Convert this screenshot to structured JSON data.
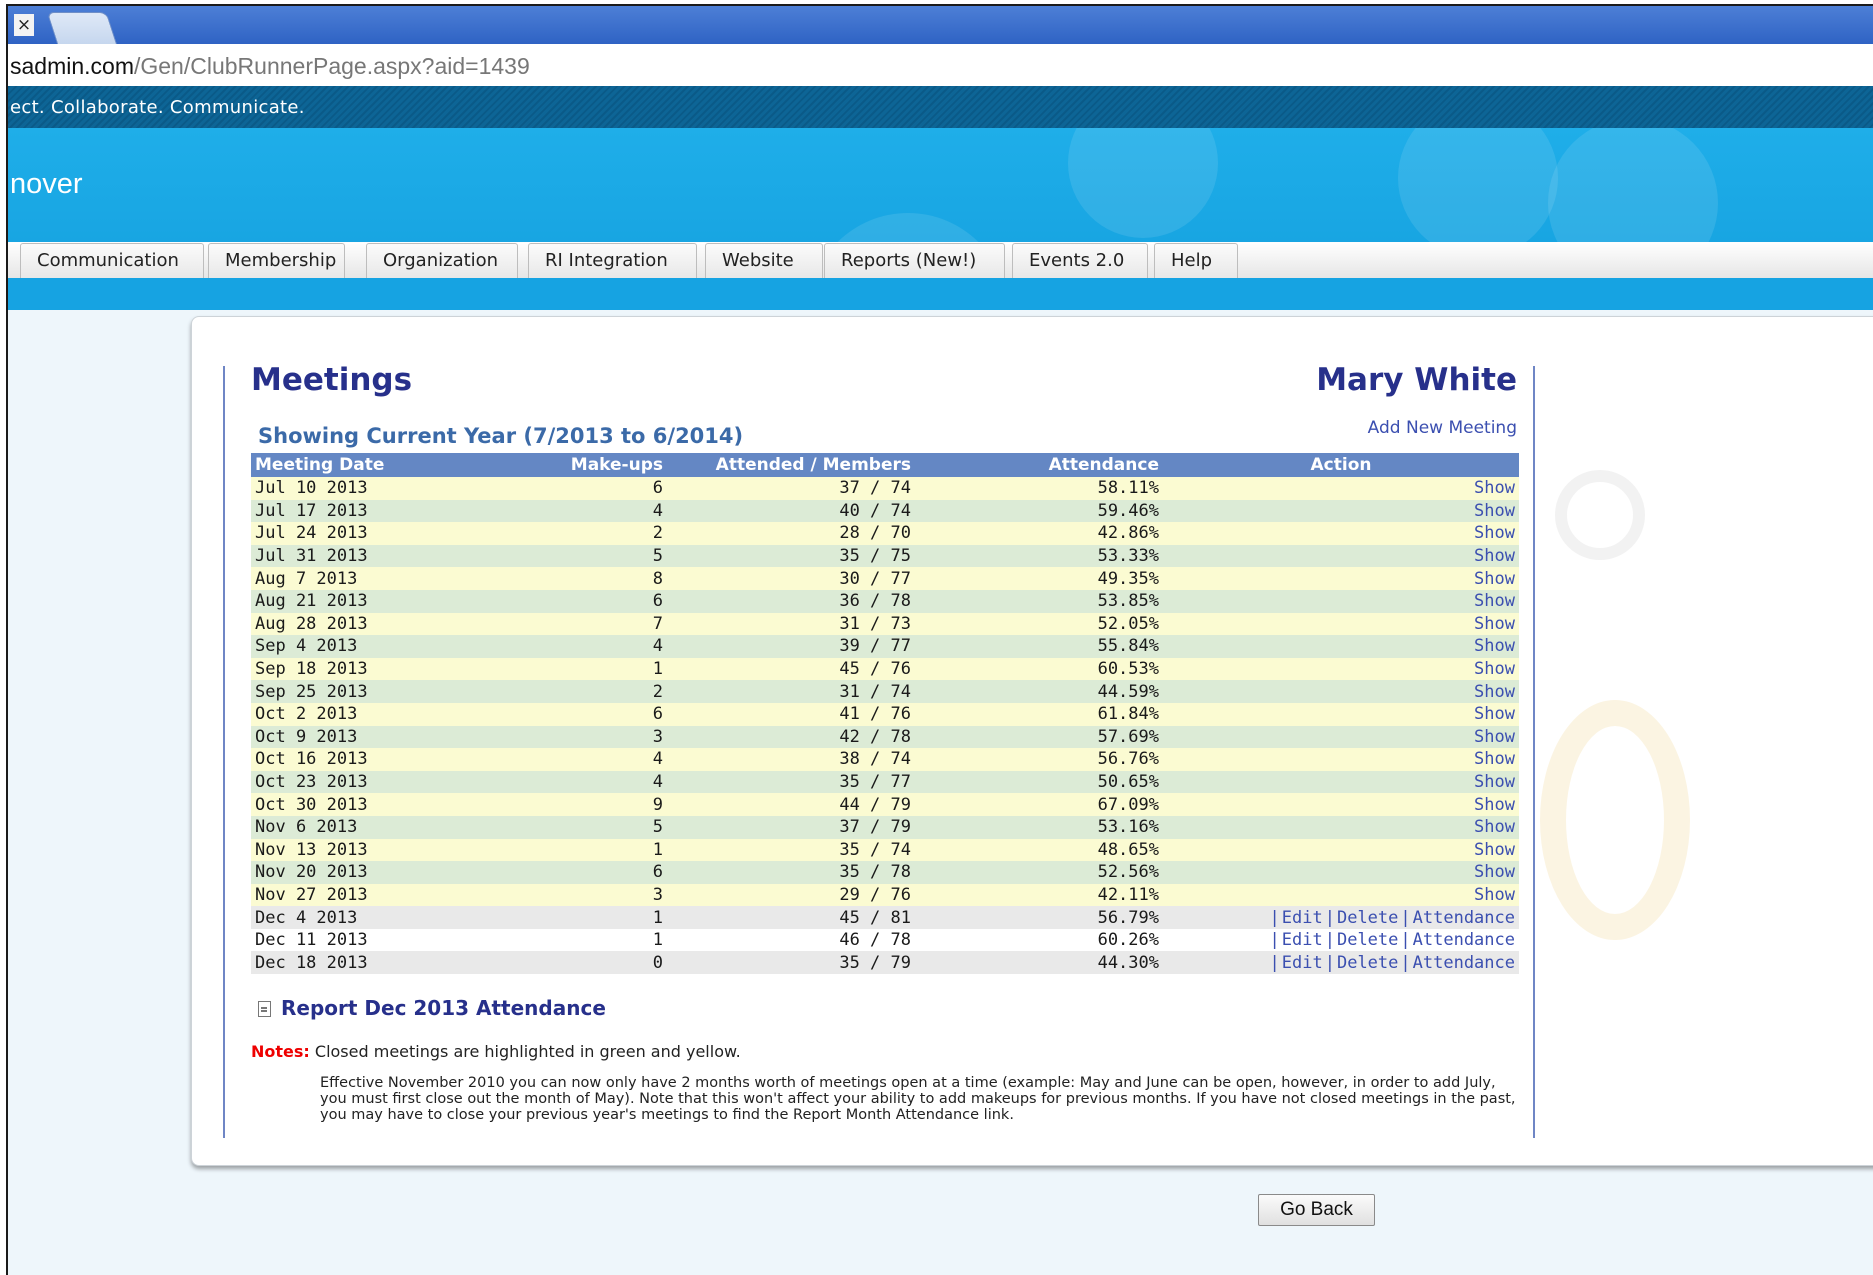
{
  "browser": {
    "tab_close": "×",
    "url_host": "sadmin.com",
    "url_path": "/Gen/ClubRunnerPage.aspx?aid=1439"
  },
  "header": {
    "tagline": "ect. Collaborate. Communicate.",
    "site_title": "nover"
  },
  "nav": {
    "items": [
      "Communication",
      "Membership",
      "Organization",
      "RI Integration",
      "Website",
      "Reports (New!)",
      "Events 2.0",
      "Help"
    ]
  },
  "main": {
    "title": "Meetings",
    "user_name": "Mary White",
    "showing": "Showing Current Year (7/2013 to 6/2014)",
    "add_new": "Add New Meeting",
    "columns": {
      "date": "Meeting Date",
      "makeups": "Make-ups",
      "attended": "Attended /  Members",
      "attendance": "Attendance",
      "action": "Action"
    },
    "rows": [
      {
        "date": "Jul 10 2013",
        "makeups": "6",
        "attended": "37 /  74",
        "pct": "58.11%",
        "status": "closed"
      },
      {
        "date": "Jul 17 2013",
        "makeups": "4",
        "attended": "40 /  74",
        "pct": "59.46%",
        "status": "closed"
      },
      {
        "date": "Jul 24 2013",
        "makeups": "2",
        "attended": "28 /  70",
        "pct": "42.86%",
        "status": "closed"
      },
      {
        "date": "Jul 31 2013",
        "makeups": "5",
        "attended": "35 /  75",
        "pct": "53.33%",
        "status": "closed"
      },
      {
        "date": "Aug 7 2013",
        "makeups": "8",
        "attended": "30 /  77",
        "pct": "49.35%",
        "status": "closed"
      },
      {
        "date": "Aug 21 2013",
        "makeups": "6",
        "attended": "36 /  78",
        "pct": "53.85%",
        "status": "closed"
      },
      {
        "date": "Aug 28 2013",
        "makeups": "7",
        "attended": "31 /  73",
        "pct": "52.05%",
        "status": "closed"
      },
      {
        "date": "Sep 4 2013",
        "makeups": "4",
        "attended": "39 /  77",
        "pct": "55.84%",
        "status": "closed"
      },
      {
        "date": "Sep 18 2013",
        "makeups": "1",
        "attended": "45 /  76",
        "pct": "60.53%",
        "status": "closed"
      },
      {
        "date": "Sep 25 2013",
        "makeups": "2",
        "attended": "31 /  74",
        "pct": "44.59%",
        "status": "closed"
      },
      {
        "date": "Oct 2 2013",
        "makeups": "6",
        "attended": "41 /  76",
        "pct": "61.84%",
        "status": "closed"
      },
      {
        "date": "Oct 9 2013",
        "makeups": "3",
        "attended": "42 /  78",
        "pct": "57.69%",
        "status": "closed"
      },
      {
        "date": "Oct 16 2013",
        "makeups": "4",
        "attended": "38 /  74",
        "pct": "56.76%",
        "status": "closed"
      },
      {
        "date": "Oct 23 2013",
        "makeups": "4",
        "attended": "35 /  77",
        "pct": "50.65%",
        "status": "closed"
      },
      {
        "date": "Oct 30 2013",
        "makeups": "9",
        "attended": "44 /  79",
        "pct": "67.09%",
        "status": "closed"
      },
      {
        "date": "Nov 6 2013",
        "makeups": "5",
        "attended": "37 /  79",
        "pct": "53.16%",
        "status": "closed"
      },
      {
        "date": "Nov 13 2013",
        "makeups": "1",
        "attended": "35 /  74",
        "pct": "48.65%",
        "status": "closed"
      },
      {
        "date": "Nov 20 2013",
        "makeups": "6",
        "attended": "35 /  78",
        "pct": "52.56%",
        "status": "closed"
      },
      {
        "date": "Nov 27 2013",
        "makeups": "3",
        "attended": "29 /  76",
        "pct": "42.11%",
        "status": "closed"
      },
      {
        "date": "Dec 4 2013",
        "makeups": "1",
        "attended": "45 /  81",
        "pct": "56.79%",
        "status": "open"
      },
      {
        "date": "Dec 11 2013",
        "makeups": "1",
        "attended": "46 /  78",
        "pct": "60.26%",
        "status": "open"
      },
      {
        "date": "Dec 18 2013",
        "makeups": "0",
        "attended": "35 /  79",
        "pct": "44.30%",
        "status": "open"
      }
    ],
    "actions": {
      "show": "Show",
      "separator": "|",
      "edit": "Edit",
      "delete": "Delete",
      "attendance": "Attendance"
    },
    "report_link": "Report Dec  2013 Attendance",
    "notes_label": "Notes:",
    "notes_text": " Closed meetings are highlighted in green and yellow.",
    "notes_paragraph": "Effective November 2010 you can now only have 2 months worth of meetings open at a time (example: May and June can be open, however, in order to add July, you must first close out the month of May). Note that this won't affect your ability to add makeups for previous months. If you have not closed meetings in the past, you may have to close your previous year's meetings to find the Report Month Attendance link.",
    "go_back": "Go Back"
  },
  "colors": {
    "heading": "#27308b",
    "header_row": "#6487c4",
    "closed_yellow": "#fbfbd2",
    "closed_green": "#dcebd6",
    "open_gray": "#e9e9e9",
    "link": "#3b4fb0",
    "notes_red": "#ee0000"
  },
  "icons": {
    "report": "document-icon"
  }
}
